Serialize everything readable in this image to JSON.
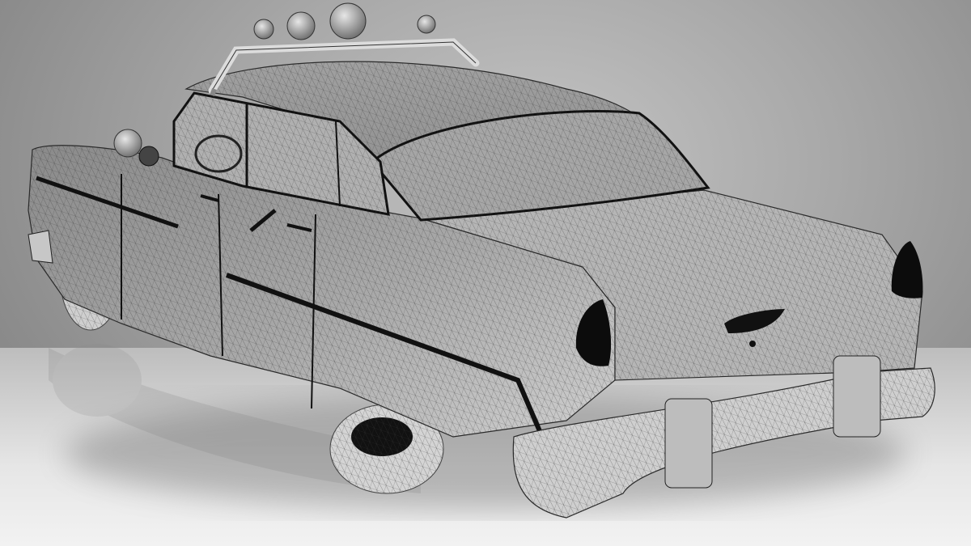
{
  "scene": {
    "subject": "car-wireframe-render",
    "colors": {
      "backdrop": "#a8a8a8",
      "floor": "#ececec",
      "body": "#8f8f8f",
      "body_highlight": "#c9c9c9",
      "wire": "#3a3a3a",
      "trim": "#111111"
    }
  }
}
